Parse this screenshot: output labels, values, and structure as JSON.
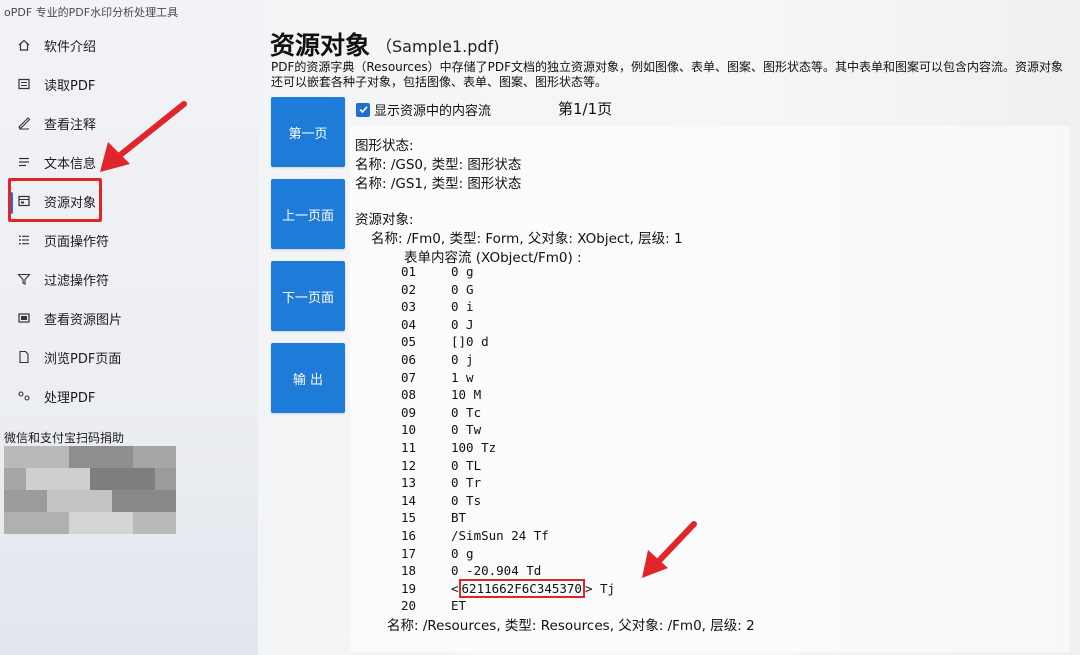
{
  "app": {
    "title": "oPDF 专业的PDF水印分析处理工具"
  },
  "sidebar": {
    "items": [
      {
        "label": "软件介绍",
        "icon": "home-icon"
      },
      {
        "label": "读取PDF",
        "icon": "pdf-read-icon"
      },
      {
        "label": "查看注释",
        "icon": "annotation-icon"
      },
      {
        "label": "文本信息",
        "icon": "text-lines-icon"
      },
      {
        "label": "资源对象",
        "icon": "resource-object-icon",
        "active": true
      },
      {
        "label": "页面操作符",
        "icon": "list-icon"
      },
      {
        "label": "过滤操作符",
        "icon": "filter-icon"
      },
      {
        "label": "查看资源图片",
        "icon": "image-icon"
      },
      {
        "label": "浏览PDF页面",
        "icon": "page-icon"
      },
      {
        "label": "处理PDF",
        "icon": "process-icon"
      }
    ],
    "donate_label": "微信和支付宝扫码捐助"
  },
  "main": {
    "title": "资源对象",
    "subtitle": "（Sample1.pdf)",
    "description": "PDF的资源字典（Resources）中存储了PDF文档的独立资源对象，例如图像、表单、图案、图形状态等。其中表单和图案可以包含内容流。资源对象还可以嵌套各种子对象，包括图像、表单、图案、图形状态等。",
    "buttons": {
      "first_page": "第一页",
      "prev_page": "上一页面",
      "next_page": "下一页面",
      "export": "输 出"
    },
    "show_content_label": "显示资源中的内容流",
    "show_content_checked": true,
    "page_indicator": "第1/1页",
    "content": {
      "graphics_state_header": "图形状态:",
      "gs_lines": [
        "名称: /GS0, 类型: 图形状态",
        "名称: /GS1, 类型: 图形状态"
      ],
      "resource_header": "资源对象:",
      "form_line": "名称: /Fm0, 类型: Form, 父对象: XObject, 层级: 1",
      "stream_header": "表单内容流 (XObject/Fm0) :",
      "ops": [
        {
          "n": "01",
          "op": "0 g"
        },
        {
          "n": "02",
          "op": "0 G"
        },
        {
          "n": "03",
          "op": "0 i"
        },
        {
          "n": "04",
          "op": "0 J"
        },
        {
          "n": "05",
          "op": "[]0 d"
        },
        {
          "n": "06",
          "op": "0 j"
        },
        {
          "n": "07",
          "op": "1 w"
        },
        {
          "n": "08",
          "op": "10 M"
        },
        {
          "n": "09",
          "op": "0 Tc"
        },
        {
          "n": "10",
          "op": "0 Tw"
        },
        {
          "n": "11",
          "op": "100 Tz"
        },
        {
          "n": "12",
          "op": "0 TL"
        },
        {
          "n": "13",
          "op": "0 Tr"
        },
        {
          "n": "14",
          "op": "0 Ts"
        },
        {
          "n": "15",
          "op": "BT"
        },
        {
          "n": "16",
          "op": "/SimSun 24 Tf"
        },
        {
          "n": "17",
          "op": "0 g"
        },
        {
          "n": "18",
          "op": "0 -20.904 Td"
        },
        {
          "n": "19",
          "op_prefix": "<",
          "op_hex": "6211662F6C345370",
          "op_suffix": "> Tj"
        },
        {
          "n": "20",
          "op": "ET"
        }
      ],
      "resources_line": "名称: /Resources, 类型: Resources, 父对象: /Fm0, 层级: 2"
    }
  },
  "colors": {
    "accent": "#1e7bd8",
    "highlight_red": "#e0262b"
  }
}
